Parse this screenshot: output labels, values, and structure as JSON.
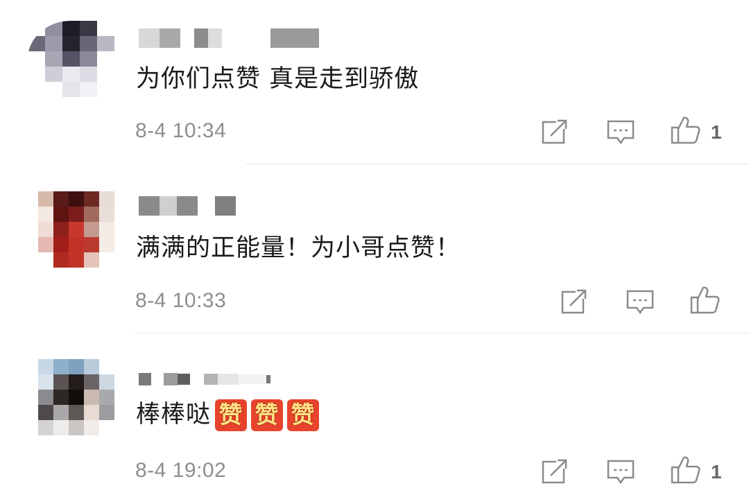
{
  "comments": [
    {
      "text": "为你们点赞 真是走到骄傲",
      "time": "8-4 10:34",
      "like_count": "1"
    },
    {
      "text": "满满的正能量！为小哥点赞！",
      "time": "8-4 10:33",
      "like_count": ""
    },
    {
      "text": "棒棒哒",
      "emoji": [
        "赞",
        "赞",
        "赞"
      ],
      "time": "8-4 19:02",
      "like_count": "1"
    }
  ],
  "icons": {
    "share": "share-icon",
    "reply": "reply-icon",
    "like": "thumbs-up-icon"
  },
  "colors": {
    "text": "#1a1a1a",
    "meta": "#8e8e8e",
    "icon": "#8a8a8a",
    "emoji_bg": "#e8432c"
  }
}
